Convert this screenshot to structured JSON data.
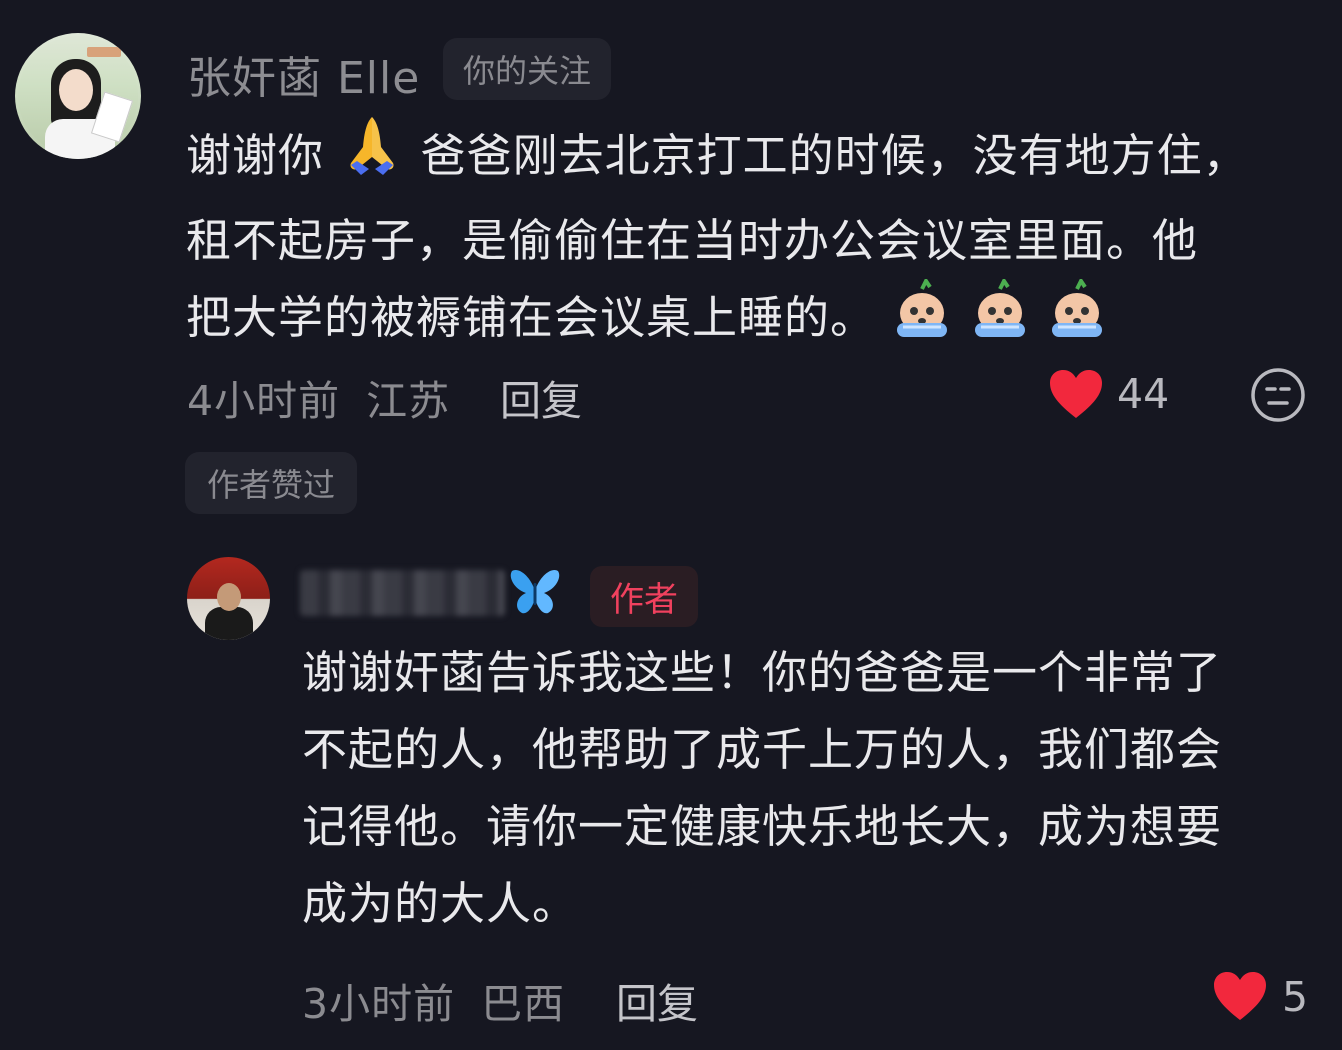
{
  "comment1": {
    "username": "张奸菡 Elle",
    "follow_badge": "你的关注",
    "text_line1_a": "谢谢你",
    "text_line1_b": "爸爸刚去北京打工的时候，没有地方住，",
    "text_line2": "租不起房子，是偷偷住在当时办公会议室里面。他",
    "text_line3": "把大学的被褥铺在会议桌上睡的。",
    "time": "4小时前",
    "location": "江苏",
    "reply_label": "回复",
    "likes": "44",
    "author_liked": "作者赞过"
  },
  "comment2": {
    "author_badge": "作者",
    "text_line1": "谢谢奸菡告诉我这些！你的爸爸是一个非常了",
    "text_line2": "不起的人，他帮助了成千上万的人，我们都会",
    "text_line3": "记得他。请你一定健康快乐地长大，成为想要",
    "text_line4": "成为的大人。",
    "time": "3小时前",
    "location": "巴西",
    "reply_label": "回复",
    "likes": "5"
  },
  "icons": {
    "like": "heart-icon",
    "dislike": "neutral-face-icon",
    "pray": "pray-icon",
    "cry": "crying-emoji-icon",
    "butterfly": "butterfly-icon"
  },
  "colors": {
    "background": "#161721",
    "like": "#f2283d",
    "author_badge": "#f0415e"
  }
}
